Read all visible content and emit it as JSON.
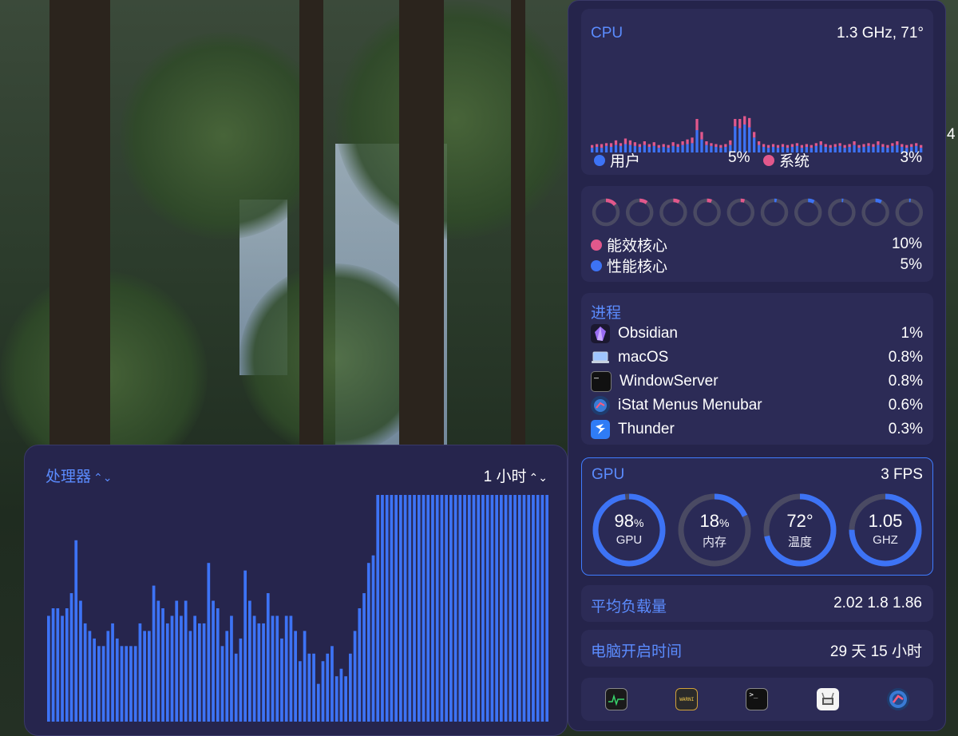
{
  "cpu": {
    "title": "CPU",
    "info": "1.3 GHz, 71°",
    "user_label": "用户",
    "user_value": "5%",
    "system_label": "系统",
    "system_value": "3%",
    "colors": {
      "user": "#3d73f5",
      "system": "#e2588c",
      "accent": "#5b8cff"
    },
    "history_user": [
      5,
      6,
      5,
      7,
      6,
      8,
      7,
      9,
      8,
      7,
      6,
      8,
      6,
      7,
      5,
      6,
      5,
      7,
      6,
      8,
      9,
      10,
      24,
      14,
      8,
      7,
      6,
      5,
      6,
      8,
      28,
      26,
      30,
      27,
      16,
      8,
      6,
      5,
      6,
      5,
      6,
      5,
      6,
      7,
      5,
      6,
      5,
      7,
      8,
      6,
      5,
      6,
      7,
      5,
      6,
      8,
      5,
      6,
      7,
      6,
      8,
      6,
      5,
      7,
      8,
      6,
      5,
      6,
      7,
      5
    ],
    "history_system": [
      3,
      3,
      4,
      3,
      4,
      5,
      3,
      6,
      5,
      4,
      3,
      4,
      3,
      4,
      3,
      3,
      3,
      4,
      3,
      4,
      5,
      6,
      12,
      8,
      4,
      3,
      3,
      3,
      3,
      5,
      8,
      10,
      9,
      10,
      6,
      4,
      3,
      3,
      3,
      3,
      3,
      3,
      3,
      3,
      3,
      3,
      3,
      3,
      4,
      3,
      3,
      3,
      3,
      3,
      3,
      4,
      3,
      3,
      3,
      3,
      4,
      3,
      3,
      3,
      4,
      3,
      3,
      3,
      3,
      3
    ]
  },
  "cores": {
    "efficiency_label": "能效核心",
    "efficiency_value": "10%",
    "performance_label": "性能核心",
    "performance_value": "5%",
    "levels": [
      {
        "kind": "e",
        "level": 0.14
      },
      {
        "kind": "e",
        "level": 0.1
      },
      {
        "kind": "e",
        "level": 0.08
      },
      {
        "kind": "e",
        "level": 0.06
      },
      {
        "kind": "e",
        "level": 0.05
      },
      {
        "kind": "p",
        "level": 0.03
      },
      {
        "kind": "p",
        "level": 0.08
      },
      {
        "kind": "p",
        "level": 0.02
      },
      {
        "kind": "p",
        "level": 0.08
      },
      {
        "kind": "p",
        "level": 0.02
      }
    ]
  },
  "processes": {
    "title": "进程",
    "items": [
      {
        "name": "Obsidian",
        "value": "1%",
        "icon": "obsidian-icon"
      },
      {
        "name": "macOS",
        "value": "0.8%",
        "icon": "macos-icon"
      },
      {
        "name": "WindowServer",
        "value": "0.8%",
        "icon": "windowserver-icon"
      },
      {
        "name": "iStat Menus Menubar",
        "value": "0.6%",
        "icon": "istat-icon"
      },
      {
        "name": "Thunder",
        "value": "0.3%",
        "icon": "thunder-icon"
      }
    ]
  },
  "gpu": {
    "title": "GPU",
    "fps": "3 FPS",
    "gauges": [
      {
        "value": "98",
        "unit": "%",
        "label": "GPU",
        "level": 0.98
      },
      {
        "value": "18",
        "unit": "%",
        "label": "内存",
        "level": 0.18
      },
      {
        "value": "72°",
        "unit": "",
        "label": "温度",
        "level": 0.72
      },
      {
        "value": "1.05",
        "unit": "",
        "label": "GHZ",
        "level": 0.75
      }
    ]
  },
  "load": {
    "title": "平均负载量",
    "value": "2.02 1.8 1.86"
  },
  "uptime": {
    "title": "电脑开启时间",
    "value": "29 天 15 小时"
  },
  "dock": {
    "items": [
      {
        "icon": "activity-monitor-icon"
      },
      {
        "icon": "console-icon",
        "text": "WARNI"
      },
      {
        "icon": "terminal-icon",
        "text": ">_"
      },
      {
        "icon": "system-info-icon"
      },
      {
        "icon": "istat-menus-icon"
      }
    ]
  },
  "processor_panel": {
    "title": "处理器",
    "range": "1 小时",
    "history": [
      14,
      15,
      15,
      14,
      15,
      17,
      24,
      16,
      13,
      12,
      11,
      10,
      10,
      12,
      13,
      11,
      10,
      10,
      10,
      10,
      13,
      12,
      12,
      18,
      16,
      15,
      13,
      14,
      16,
      14,
      16,
      12,
      14,
      13,
      13,
      21,
      16,
      15,
      10,
      12,
      14,
      9,
      11,
      20,
      16,
      14,
      13,
      13,
      17,
      14,
      14,
      11,
      14,
      14,
      12,
      8,
      12,
      9,
      9,
      5,
      8,
      9,
      10,
      6,
      7,
      6,
      9,
      12,
      15,
      17,
      21,
      22,
      30,
      30,
      30,
      30,
      30,
      30,
      30,
      30,
      30,
      30,
      30,
      30,
      30,
      30,
      30,
      30,
      30,
      30,
      30,
      30,
      30,
      30,
      30,
      30,
      30,
      30,
      30,
      30,
      30,
      30,
      30,
      30,
      30,
      30,
      30,
      30,
      30,
      30
    ]
  },
  "edge_text": "4"
}
